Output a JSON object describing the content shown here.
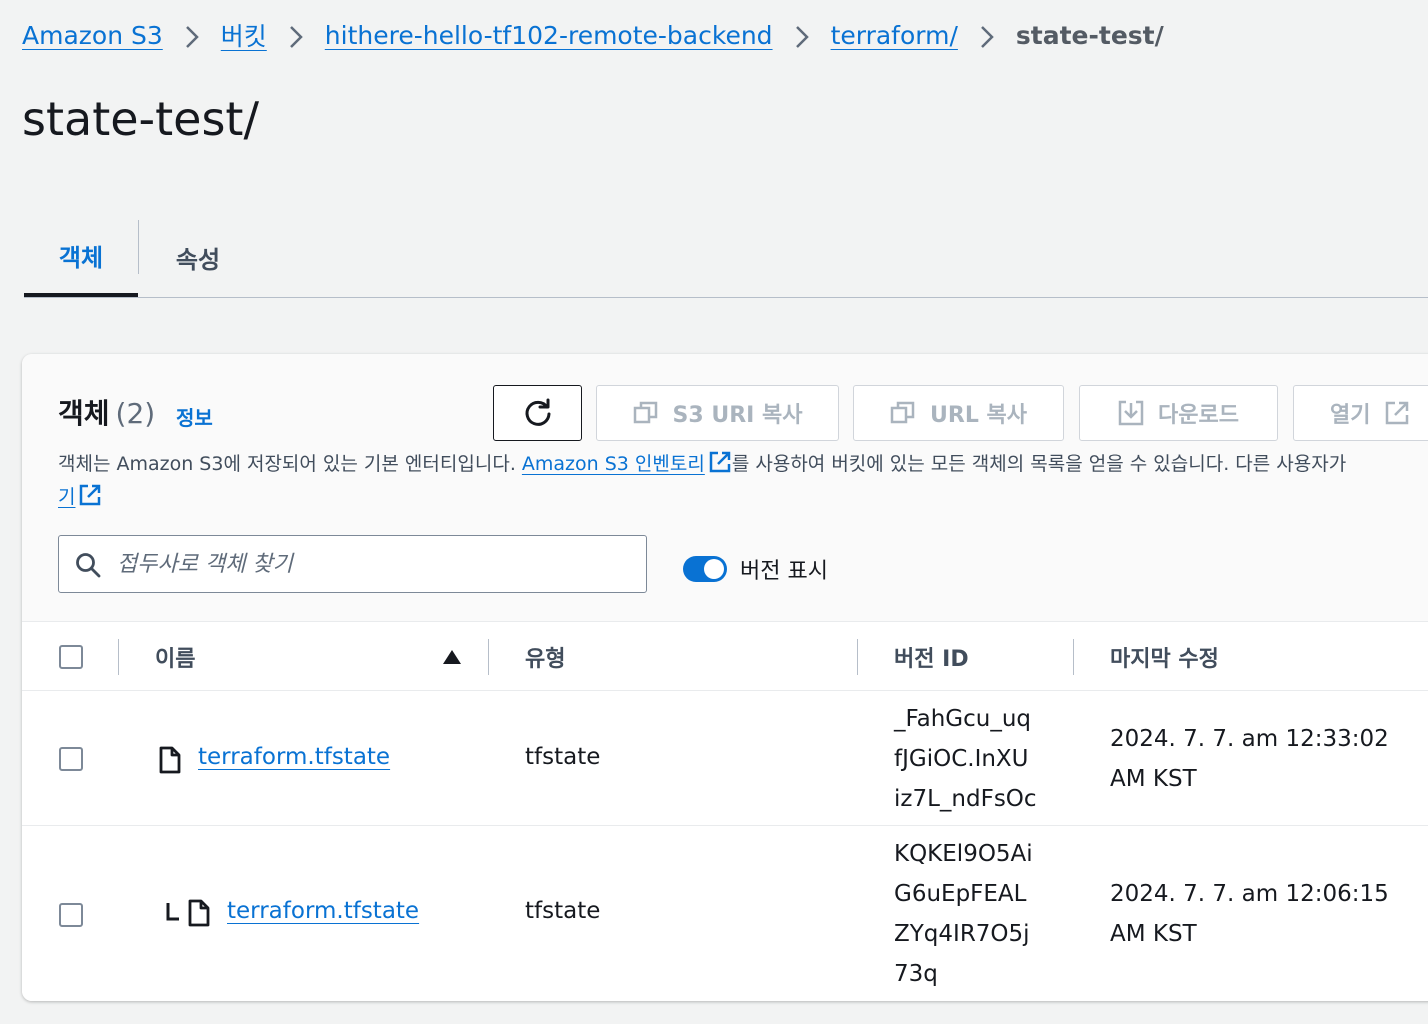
{
  "breadcrumb": {
    "items": [
      "Amazon S3",
      "버킷",
      "hithere-hello-tf102-remote-backend",
      "terraform/"
    ],
    "current": "state-test/"
  },
  "page": {
    "title": "state-test/"
  },
  "tabs": [
    "객체",
    "속성"
  ],
  "panel": {
    "title": "객체",
    "count": "(2)",
    "info": "정보",
    "buttons": {
      "copy_s3_uri": "S3 URI 복사",
      "copy_url": "URL 복사",
      "download": "다운로드",
      "open": "열기"
    },
    "description": {
      "before_link": "객체는 Amazon S3에 저장되어 있는 기본 엔터티입니다. ",
      "link": "Amazon S3 인벤토리",
      "after_link": "를 사용하여 버킷에 있는 모든 객체의 목록을 얻을 수 있습니다. 다른 사용자가 ",
      "line2_link": "기"
    },
    "search": {
      "placeholder": "접두사로 객체 찾기"
    },
    "toggle": {
      "label": "버전 표시",
      "on": true
    }
  },
  "table": {
    "columns": [
      "이름",
      "유형",
      "버전 ID",
      "마지막 수정"
    ],
    "rows": [
      {
        "name": "terraform.tfstate",
        "type": "tfstate",
        "version_id": [
          "_FahGcu_uq",
          "fJGiOC.InXU",
          "iz7L_ndFsOc"
        ],
        "modified": [
          "2024. 7. 7. am 12:33:02",
          "AM KST"
        ]
      },
      {
        "name": "terraform.tfstate",
        "type": "tfstate",
        "version_id": [
          "KQKEl9O5Ai",
          "G6uEpFEAL",
          "ZYq4IR7O5j",
          "73q"
        ],
        "modified": [
          "2024. 7. 7. am 12:06:15",
          "AM KST"
        ]
      }
    ]
  },
  "colors": {
    "link": "#0972d3",
    "text": "#16191f",
    "muted": "#5f6b7a",
    "disabled": "#aab4be",
    "background": "#f2f3f3",
    "panel": "#ffffff"
  }
}
